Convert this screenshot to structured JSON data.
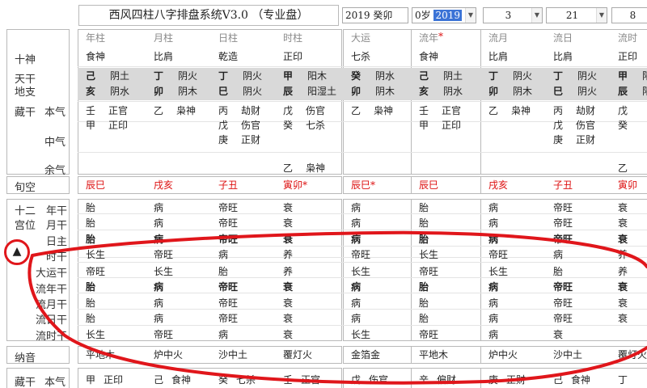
{
  "app_title": "西风四柱八字排盘系统V3.0 （专业盘）",
  "selectors": {
    "year_gz": "2019 癸卯",
    "age": "0岁",
    "year_highlight": "2019",
    "month": "3",
    "day": "21",
    "hour": "8"
  },
  "col_headers": [
    "年柱",
    "月柱",
    "日柱",
    "时柱",
    "大运",
    "流年",
    "流月",
    "流日",
    "流时"
  ],
  "row_labels": {
    "shishen": "十神",
    "tiangan": "天干",
    "dizhi": "地支",
    "zanggan": "藏干",
    "benqi": "本气",
    "zhongqi": "中气",
    "yuqi": "余气",
    "xunkong": "旬空",
    "shier": "十二",
    "gongwei": "宫位",
    "nianzhi": "年干",
    "yuezhi": "月干",
    "rizhu": "日主",
    "shigan": "时干",
    "dayungan": "大运干",
    "liunian": "流年干",
    "liuyue": "流月干",
    "liuri": "流日干",
    "liushi": "流时干",
    "nayin": "纳音",
    "zanggan2": "藏干",
    "benqi2": "本气"
  },
  "shishen": [
    "食神",
    "比肩",
    "乾造",
    "正印",
    "七杀",
    "食神",
    "比肩",
    "比肩",
    "正印"
  ],
  "tiangan": [
    [
      "己",
      "阴土"
    ],
    [
      "丁",
      "阴火"
    ],
    [
      "丁",
      "阴火"
    ],
    [
      "甲",
      "阳木"
    ],
    [
      "癸",
      "阴水"
    ],
    [
      "己",
      "阴土"
    ],
    [
      "丁",
      "阴火"
    ],
    [
      "丁",
      "阴火"
    ],
    [
      "甲",
      "阳"
    ]
  ],
  "dizhi": [
    [
      "亥",
      "阴水"
    ],
    [
      "卯",
      "阴木"
    ],
    [
      "巳",
      "阴火"
    ],
    [
      "辰",
      "阳湿土"
    ],
    [
      "卯",
      "阴木"
    ],
    [
      "亥",
      "阴水"
    ],
    [
      "卯",
      "阴木"
    ],
    [
      "巳",
      "阴火"
    ],
    [
      "辰",
      "阳"
    ]
  ],
  "benqi": [
    [
      "壬",
      "正官"
    ],
    [
      "乙",
      "枭神"
    ],
    [
      "丙",
      "劫财"
    ],
    [
      "戊",
      "伤官"
    ],
    [
      "乙",
      "枭神"
    ],
    [
      "壬",
      "正官"
    ],
    [
      "乙",
      "枭神"
    ],
    [
      "丙",
      "劫财"
    ],
    [
      "戊",
      ""
    ]
  ],
  "zhongqi": [
    [
      "甲",
      "正印"
    ],
    [
      "",
      ""
    ],
    [
      "戊",
      "伤官"
    ],
    [
      "癸",
      "七杀"
    ],
    [
      "",
      ""
    ],
    [
      "甲",
      "正印"
    ],
    [
      "",
      ""
    ],
    [
      "戊",
      "伤官"
    ],
    [
      "癸",
      ""
    ]
  ],
  "zhongqi_b": [
    [
      "",
      ""
    ],
    [
      "",
      ""
    ],
    [
      "庚",
      "正财"
    ],
    [
      "",
      ""
    ],
    [
      "",
      ""
    ],
    [
      "",
      ""
    ],
    [
      "",
      ""
    ],
    [
      "庚",
      "正财"
    ],
    [
      "",
      ""
    ]
  ],
  "yuqi": [
    [
      "",
      ""
    ],
    [
      "",
      ""
    ],
    [
      "",
      ""
    ],
    [
      "乙",
      "枭神"
    ],
    [
      "",
      ""
    ],
    [
      "",
      ""
    ],
    [
      "",
      ""
    ],
    [
      "",
      ""
    ],
    [
      "乙",
      ""
    ]
  ],
  "xunkong": [
    "辰巳",
    "戌亥",
    "子丑",
    "寅卯*",
    "辰巳*",
    "辰巳",
    "戌亥",
    "子丑",
    "寅卯"
  ],
  "twelve_rows": [
    [
      "胎",
      "病",
      "帝旺",
      "衰",
      "病",
      "胎",
      "病",
      "帝旺",
      "衰"
    ],
    [
      "胎",
      "病",
      "帝旺",
      "衰",
      "病",
      "胎",
      "病",
      "帝旺",
      "衰"
    ],
    [
      "胎",
      "病",
      "帝旺",
      "衰",
      "病",
      "胎",
      "病",
      "帝旺",
      "衰"
    ],
    [
      "长生",
      "帝旺",
      "病",
      "养",
      "帝旺",
      "长生",
      "帝旺",
      "病",
      "养"
    ],
    [
      "帝旺",
      "长生",
      "胎",
      "养",
      "长生",
      "帝旺",
      "长生",
      "胎",
      "养"
    ],
    [
      "胎",
      "病",
      "帝旺",
      "衰",
      "病",
      "胎",
      "病",
      "帝旺",
      "衰"
    ],
    [
      "胎",
      "病",
      "帝旺",
      "衰",
      "病",
      "胎",
      "病",
      "帝旺",
      "衰"
    ],
    [
      "胎",
      "病",
      "帝旺",
      "衰",
      "病",
      "胎",
      "病",
      "帝旺",
      "衰"
    ],
    [
      "长生",
      "帝旺",
      "病",
      "衰",
      "长生",
      "帝旺",
      "病",
      "衰"
    ]
  ],
  "nayin": [
    "平地木",
    "炉中火",
    "沙中土",
    "覆灯火",
    "金箔金",
    "平地木",
    "炉中火",
    "沙中土",
    "覆灯火"
  ],
  "bottom_zang": [
    [
      "甲",
      "正印"
    ],
    [
      "己",
      "食神"
    ],
    [
      "癸",
      "七杀"
    ],
    [
      "壬",
      "正官"
    ],
    [
      "戊",
      "伤官"
    ],
    [
      "辛",
      "偏财"
    ],
    [
      "庚",
      "正财"
    ],
    [
      "己",
      "食神"
    ],
    [
      "丁",
      ""
    ]
  ],
  "overlay_arrow": "▲",
  "colors": {
    "red": "#dd1111",
    "gray": "#d9d9d9",
    "annot": "#e0161b"
  }
}
